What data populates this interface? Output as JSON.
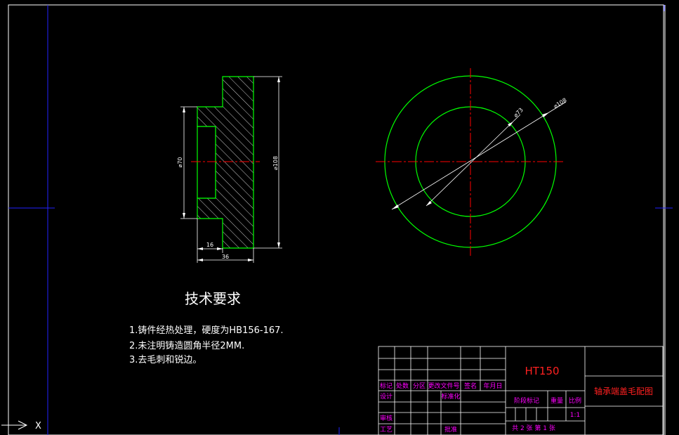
{
  "colors": {
    "background": "#000000",
    "frame": "#ffffff",
    "outline": "#00ff00",
    "centerline": "#ff0000",
    "dimension": "#ffffff",
    "crosshair": "#0000ff",
    "table_magenta": "#ff00ff",
    "table_red": "#ff0000"
  },
  "section_view": {
    "dim_dia_outer": "⌀108",
    "dim_dia_inner": "⌀70",
    "dim_len_16": "16",
    "dim_len_36": "36"
  },
  "circle_view": {
    "dim_dia_inner": "⌀73",
    "dim_dia_outer": "⌀108"
  },
  "tech_requirements": {
    "title": "技术要求",
    "items": [
      "1.铸件经热处理，硬度为HB156-167.",
      "2.未注明铸造圆角半径2MM.",
      "3.去毛刺和锐边。"
    ]
  },
  "title_block": {
    "material": "HT150",
    "part_name": "轴承端盖毛配图",
    "row_labels": [
      "标记",
      "处数",
      "分区",
      "更改文件号",
      "签名",
      "年月日"
    ],
    "design": "设计",
    "standardize": "标准化",
    "review": "审核",
    "process": "工艺",
    "approve": "批准",
    "stage_mark": "阶段标记",
    "weight": "重量",
    "scale": "比例",
    "scale_value": "1:1",
    "sheets": "共 2 张 第 1 张"
  },
  "ucs_icon": {
    "label": "X"
  }
}
